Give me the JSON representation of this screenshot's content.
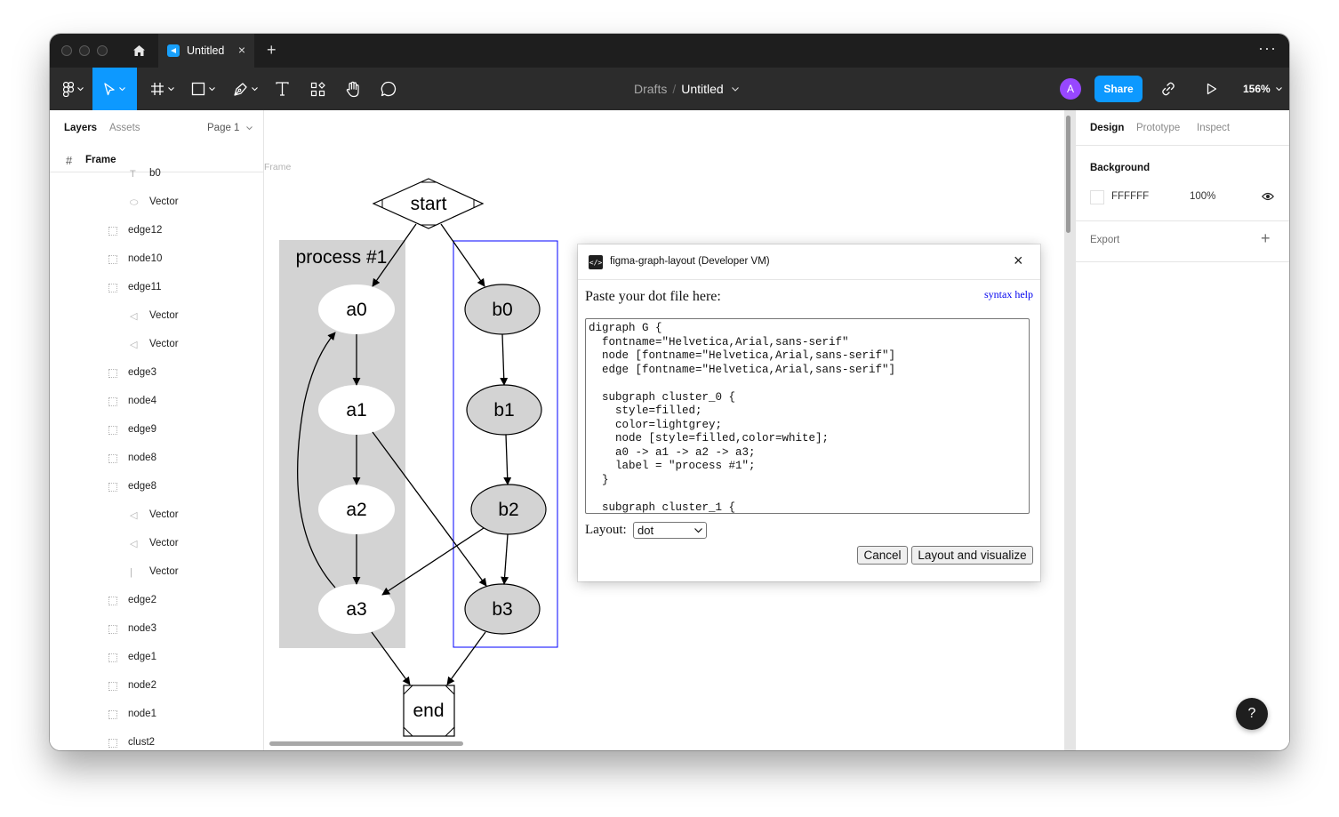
{
  "titlebar": {
    "tab_title": "Untitled",
    "tab_close": "×",
    "new_tab": "+",
    "more": "···"
  },
  "toolbar": {
    "breadcrumb_drafts": "Drafts",
    "breadcrumb_sep": "/",
    "file_name": "Untitled",
    "avatar_initial": "A",
    "share_label": "Share",
    "zoom_label": "156%"
  },
  "left_panel": {
    "tab_layers": "Layers",
    "tab_assets": "Assets",
    "page_label": "Page 1",
    "frame_name": "Frame",
    "layers": [
      {
        "name": "b0",
        "icon": "text-icon"
      },
      {
        "name": "Vector",
        "icon": "ellipse-icon"
      },
      {
        "name": "edge12",
        "icon": "group-icon"
      },
      {
        "name": "node10",
        "icon": "group-icon"
      },
      {
        "name": "edge11",
        "icon": "group-icon"
      },
      {
        "name": "Vector",
        "icon": "vector-icon"
      },
      {
        "name": "Vector",
        "icon": "vector-icon"
      },
      {
        "name": "edge3",
        "icon": "group-icon"
      },
      {
        "name": "node4",
        "icon": "group-icon"
      },
      {
        "name": "edge9",
        "icon": "group-icon"
      },
      {
        "name": "node8",
        "icon": "group-icon"
      },
      {
        "name": "edge8",
        "icon": "group-icon"
      },
      {
        "name": "Vector",
        "icon": "vector-icon"
      },
      {
        "name": "Vector",
        "icon": "vector-icon"
      },
      {
        "name": "Vector",
        "icon": "line-icon"
      },
      {
        "name": "edge2",
        "icon": "group-icon"
      },
      {
        "name": "node3",
        "icon": "group-icon"
      },
      {
        "name": "edge1",
        "icon": "group-icon"
      },
      {
        "name": "node2",
        "icon": "group-icon"
      },
      {
        "name": "node1",
        "icon": "group-icon"
      },
      {
        "name": "clust2",
        "icon": "group-icon"
      }
    ]
  },
  "canvas": {
    "frame_label": "Frame",
    "graph": {
      "cluster_label": "process #1",
      "start": "start",
      "end": "end",
      "a_nodes": [
        "a0",
        "a1",
        "a2",
        "a3"
      ],
      "b_nodes": [
        "b0",
        "b1",
        "b2",
        "b3"
      ],
      "cluster_color": "#d3d3d3",
      "b_node_fill": "#d3d3d3",
      "selection_color": "#0000ff"
    }
  },
  "plugin": {
    "title": "figma-graph-layout (Developer VM)",
    "close": "×",
    "paste_label": "Paste your dot file here:",
    "syntax_help": "syntax help",
    "dot_source": "digraph G {\n  fontname=\"Helvetica,Arial,sans-serif\"\n  node [fontname=\"Helvetica,Arial,sans-serif\"]\n  edge [fontname=\"Helvetica,Arial,sans-serif\"]\n\n  subgraph cluster_0 {\n    style=filled;\n    color=lightgrey;\n    node [style=filled,color=white];\n    a0 -> a1 -> a2 -> a3;\n    label = \"process #1\";\n  }\n\n  subgraph cluster_1 {",
    "layout_label": "Layout:",
    "layout_value": "dot",
    "cancel_label": "Cancel",
    "submit_label": "Layout and visualize"
  },
  "right_panel": {
    "tab_design": "Design",
    "tab_prototype": "Prototype",
    "tab_inspect": "Inspect",
    "background_title": "Background",
    "bg_hex": "FFFFFF",
    "bg_opacity": "100%",
    "export_title": "Export",
    "export_add": "+",
    "help": "?"
  },
  "colors": {
    "accent": "#0d99ff",
    "toolbar_bg": "#2c2c2c",
    "titlebar_bg": "#1e1e1e",
    "avatar": "#9747ff"
  }
}
